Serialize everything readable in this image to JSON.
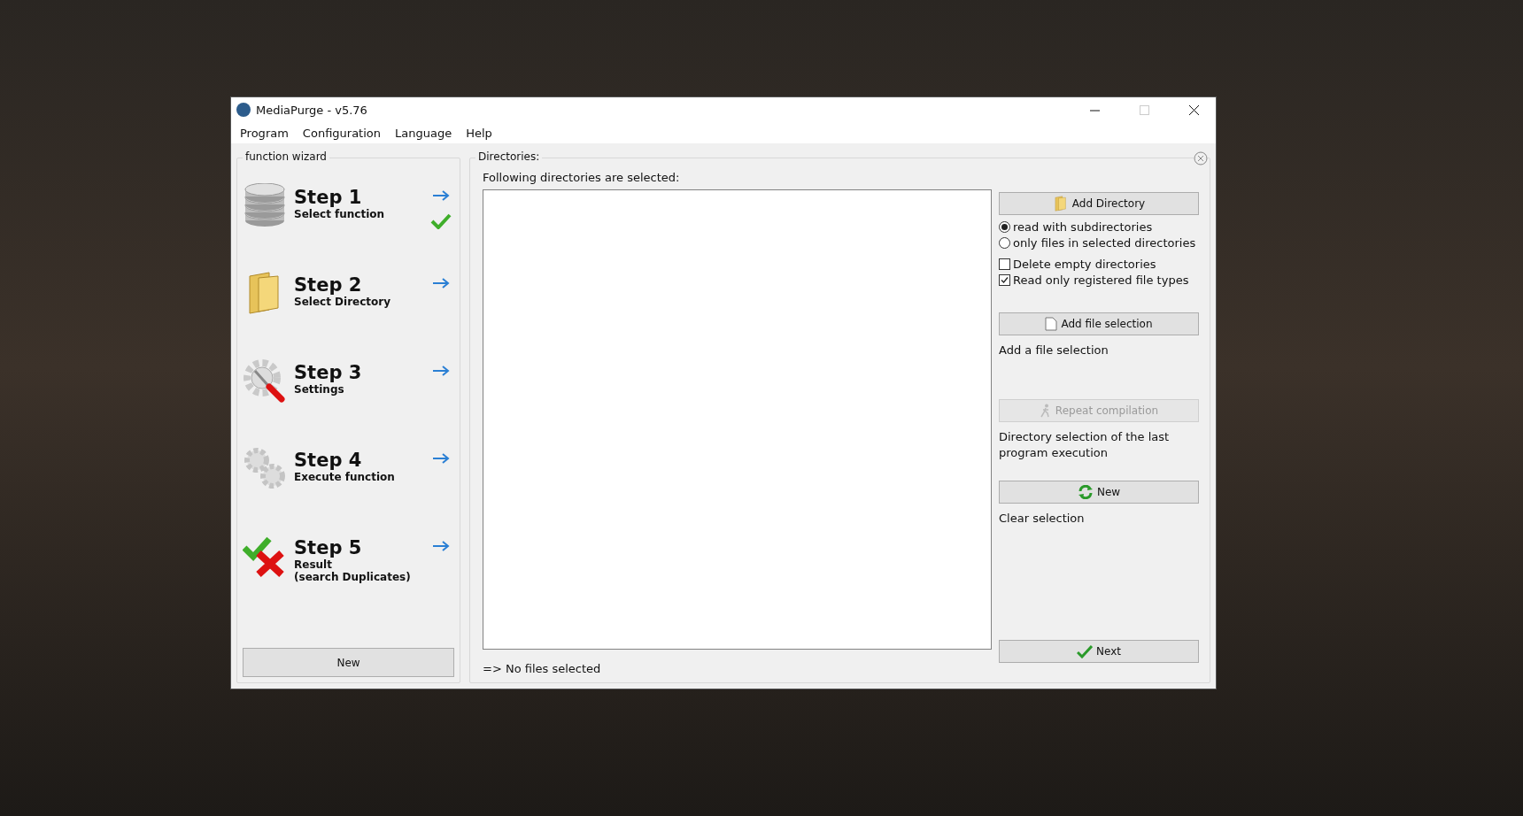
{
  "window": {
    "title": "MediaPurge - v5.76"
  },
  "menu": [
    "Program",
    "Configuration",
    "Language",
    "Help"
  ],
  "wizard": {
    "title": "function wizard",
    "steps": [
      {
        "kind": "database",
        "title": "Step 1",
        "lines": [
          "Select function"
        ],
        "done": true
      },
      {
        "kind": "folder",
        "title": "Step 2",
        "lines": [
          "Select Directory"
        ],
        "done": false
      },
      {
        "kind": "settings",
        "title": "Step 3",
        "lines": [
          "Settings"
        ],
        "done": false
      },
      {
        "kind": "gears",
        "title": "Step 4",
        "lines": [
          "Execute function"
        ],
        "done": false
      },
      {
        "kind": "result",
        "title": "Step 5",
        "lines": [
          "Result",
          "(search Duplicates)"
        ],
        "done": false
      }
    ],
    "button": "New"
  },
  "directories": {
    "title": "Directories:",
    "heading": "Following directories are selected:",
    "status": "=> No files selected",
    "add_button": {
      "kind": "folder",
      "label": "Add Directory"
    },
    "read_modes": [
      {
        "label": "read with subdirectories",
        "selected": true
      },
      {
        "label": "only files in selected directories",
        "selected": false
      }
    ],
    "options": [
      {
        "label": "Delete empty directories",
        "checked": false
      },
      {
        "label": "Read only registered file types",
        "checked": true
      }
    ],
    "actions": [
      {
        "kind": "file",
        "label": "Add file selection",
        "disabled": false,
        "description": "Add a file selection"
      },
      {
        "kind": "walker",
        "label": "Repeat compilation",
        "disabled": true,
        "description": "Directory selection of the last program execution"
      },
      {
        "kind": "refresh",
        "label": "New",
        "disabled": false,
        "description": "Clear selection"
      }
    ],
    "next_button": {
      "kind": "check",
      "label": "Next"
    }
  }
}
